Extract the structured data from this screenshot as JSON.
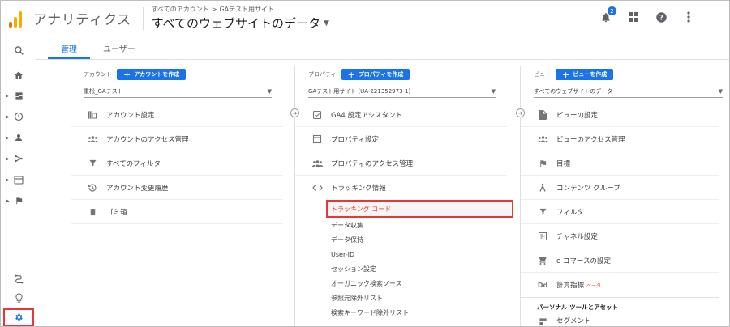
{
  "header": {
    "app_title": "アナリティクス",
    "crumb_all_accounts": "すべてのアカウント",
    "crumb_sep": ">",
    "crumb_property": "GAテスト用サイト",
    "view_title": "すべてのウェブサイトのデータ",
    "notification_count": "2"
  },
  "tabs": [
    {
      "label": "管理",
      "active": true
    },
    {
      "label": "ユーザー",
      "active": false
    }
  ],
  "account": {
    "label": "アカウント",
    "create_label": "アカウントを作成",
    "selected": "重松_GAテスト",
    "items": [
      {
        "label": "アカウント設定",
        "icon": "building-icon"
      },
      {
        "label": "アカウントのアクセス管理",
        "icon": "people-icon"
      },
      {
        "label": "すべてのフィルタ",
        "icon": "filter-icon"
      },
      {
        "label": "アカウント変更履歴",
        "icon": "history-icon"
      },
      {
        "label": "ゴミ箱",
        "icon": "trash-icon"
      }
    ]
  },
  "property": {
    "label": "プロパティ",
    "create_label": "プロパティを作成",
    "selected": "GAテスト用サイト (UA-221352973-1)",
    "items": [
      {
        "label": "GA4 設定アシスタント",
        "icon": "checkbox-icon"
      },
      {
        "label": "プロパティ設定",
        "icon": "window-icon"
      },
      {
        "label": "プロパティのアクセス管理",
        "icon": "people-icon"
      },
      {
        "label": "トラッキング情報",
        "icon": "code-icon"
      }
    ],
    "tracking_sub": [
      "トラッキング コード",
      "データ収集",
      "データ保持",
      "User-ID",
      "セッション設定",
      "オーガニック検索ソース",
      "参照元除外リスト",
      "検索キーワード除外リスト"
    ]
  },
  "view": {
    "label": "ビュー",
    "create_label": "ビューを作成",
    "selected": "すべてのウェブサイトのデータ",
    "items": [
      {
        "label": "ビューの設定",
        "icon": "document-icon"
      },
      {
        "label": "ビューのアクセス管理",
        "icon": "people-icon"
      },
      {
        "label": "目標",
        "icon": "flag-icon"
      },
      {
        "label": "コンテンツ グループ",
        "icon": "person-walk-icon"
      },
      {
        "label": "フィルタ",
        "icon": "filter-icon"
      },
      {
        "label": "チャネル設定",
        "icon": "channel-icon"
      },
      {
        "label": "e コマースの設定",
        "icon": "cart-icon"
      },
      {
        "label": "計算指標",
        "icon": "dd-icon"
      }
    ],
    "beta_label": "ベータ",
    "dd_label": "Dd",
    "section_title": "パーソナル ツールとアセット",
    "partial_item": "セグメント"
  }
}
